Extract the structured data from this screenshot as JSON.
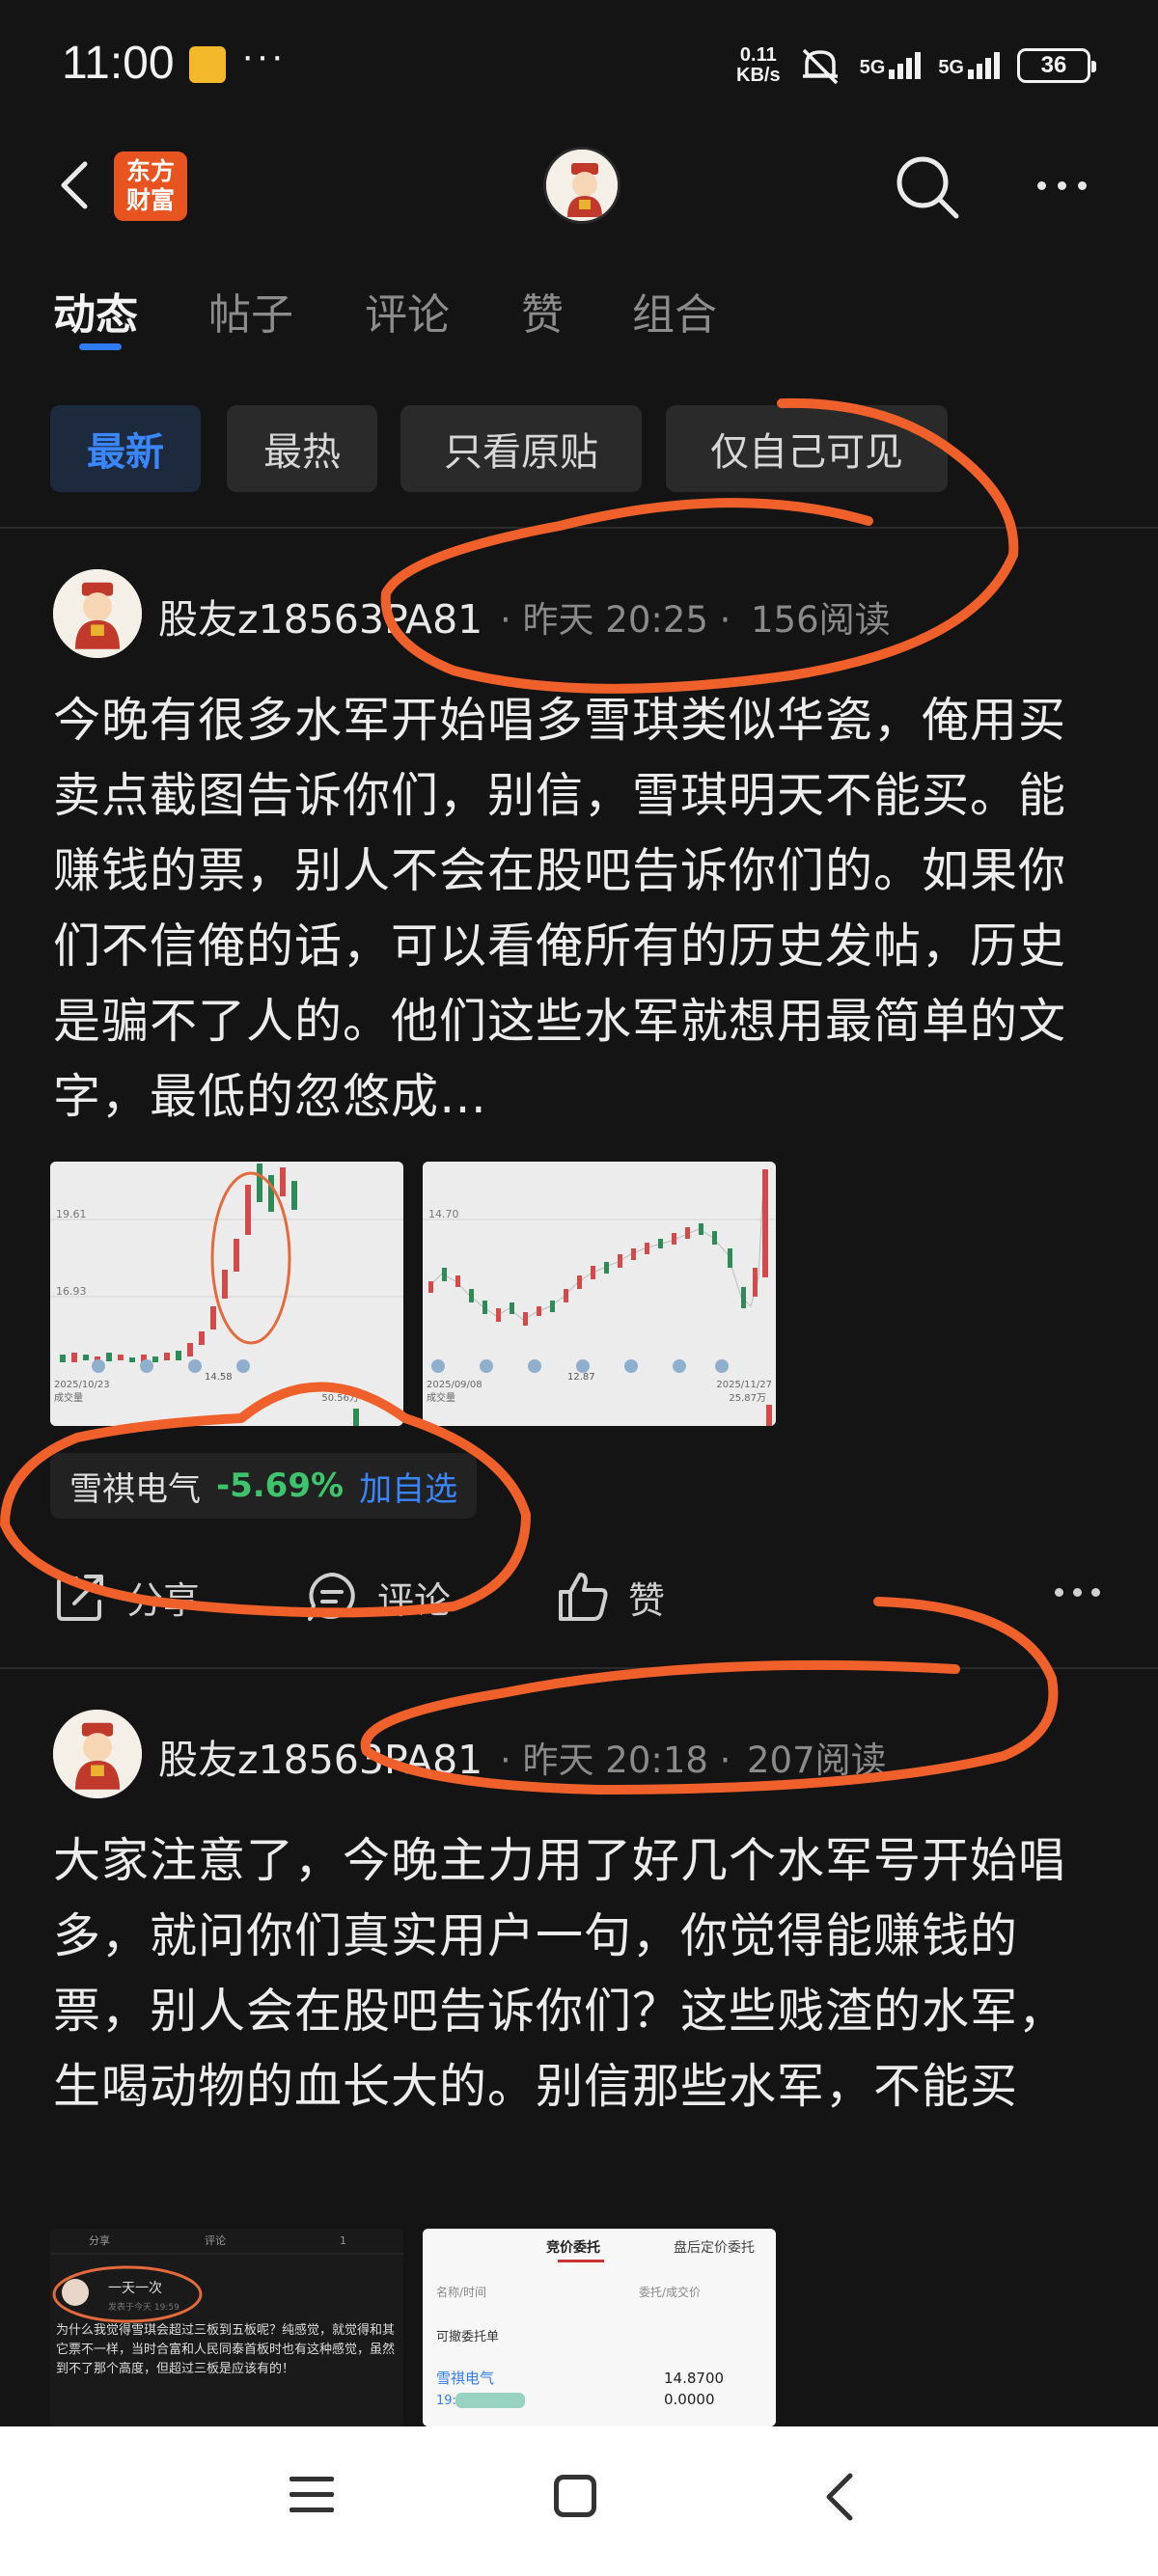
{
  "status_bar": {
    "time": "11:00",
    "more": "···",
    "net_speed_value": "0.11",
    "net_speed_unit": "KB/s",
    "signal_1": "5G",
    "signal_2": "5G",
    "battery": "36"
  },
  "top_nav": {
    "brand_line1": "东方",
    "brand_line2": "财富",
    "icons": [
      "back-icon",
      "search-icon",
      "more-icon"
    ]
  },
  "tabs": [
    {
      "label": "动态",
      "active": true
    },
    {
      "label": "帖子"
    },
    {
      "label": "评论"
    },
    {
      "label": "赞"
    },
    {
      "label": "组合"
    }
  ],
  "filters": [
    {
      "label": "最新",
      "active": true
    },
    {
      "label": "最热"
    },
    {
      "label": "只看原贴"
    },
    {
      "label": "仅自己可见"
    }
  ],
  "posts": [
    {
      "user": "股友z18563PA81",
      "time": "· 昨天 20:25 ·",
      "reads": "156阅读",
      "body": "今晚有很多水军开始唱多雪琪类似华瓷，俺用买卖点截图告诉你们，别信，雪琪明天不能买。能赚钱的票，别人不会在股吧告诉你们的。如果你们不信俺的话，可以看俺所有的历史发帖，历史是骗不了人的。他们这些水军就想用最简单的文字，最低的忽悠成…",
      "thumb1": {
        "y_high": "19.61",
        "y_low": "16.93",
        "date": "2025/10/23",
        "volume_label": "成交量",
        "low_mark": "14.58",
        "volume_value": "50.56万"
      },
      "thumb2": {
        "y_high": "14.70",
        "date_start": "2025/09/08",
        "date_end": "2025/11/27",
        "volume_label": "成交量",
        "low_mark": "12.87",
        "volume_value": "25.87万"
      },
      "stock": {
        "name": "雪祺电气",
        "change": "-5.69%",
        "add": "加自选"
      },
      "actions": {
        "share": "分享",
        "comment": "评论",
        "like": "赞"
      }
    },
    {
      "user": "股友z18563PA81",
      "time": "· 昨天 20:18 ·",
      "reads": "207阅读",
      "body": "大家注意了，今晚主力用了好几个水军号开始唱多，就问你们真实用户一句，你觉得能赚钱的票，别人会在股吧告诉你们？这些贱渣的水军，生喝动物的血长大的。别信那些水军，不能买",
      "thumb1": {
        "share": "分享",
        "comment": "评论",
        "like": "1",
        "name": "一天一次",
        "sub": "发表于今天 19:59",
        "text": "为什么我觉得雪琪会超过三板到五板呢？纯感觉，就觉得和其它票不一样，当时合富和人民同泰首板时也有这种感觉，虽然到不了那个高度，但超过三板是应该有的！"
      },
      "thumb2": {
        "tab1": "竞价委托",
        "tab2": "盘后定价委托",
        "col1": "名称/时间",
        "col2": "委托/成交价",
        "section": "可撤委托单",
        "stock": "雪祺电气",
        "time": "19:",
        "price1": "14.8700",
        "price2": "0.0000"
      }
    }
  ],
  "colors": {
    "accent": "#2f7cf6",
    "down": "#3ec46d",
    "brand": "#e8541f",
    "marker": "#f0602a",
    "background": "#141414"
  }
}
